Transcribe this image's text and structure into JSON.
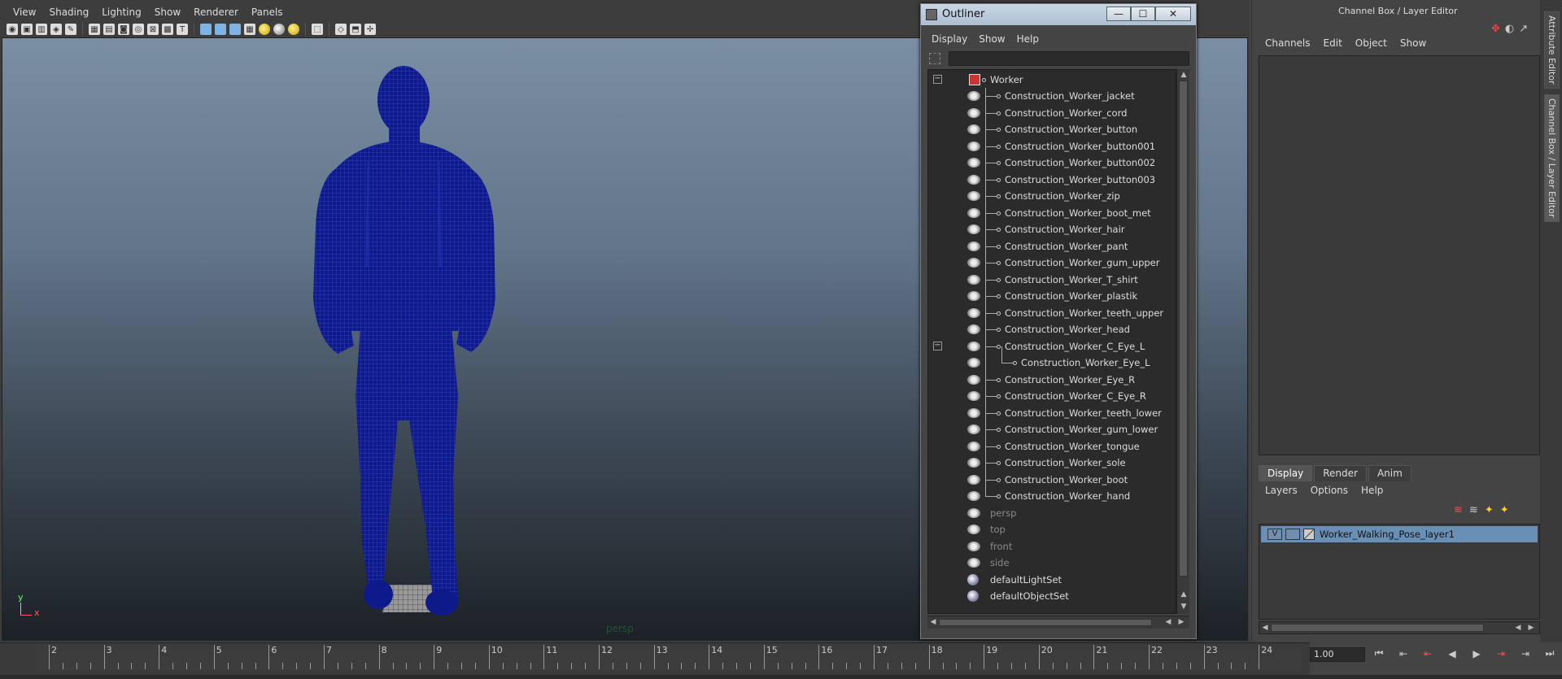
{
  "viewport": {
    "menus": [
      "View",
      "Shading",
      "Lighting",
      "Show",
      "Renderer",
      "Panels"
    ],
    "camera_label": "persp",
    "axis_y": "y",
    "axis_x": "x"
  },
  "outliner": {
    "title": "Outliner",
    "window_buttons": {
      "minimize": "—",
      "maximize": "☐",
      "close": "✕"
    },
    "menus": [
      "Display",
      "Show",
      "Help"
    ],
    "root": "Worker",
    "items": [
      "Construction_Worker_jacket",
      "Construction_Worker_cord",
      "Construction_Worker_button",
      "Construction_Worker_button001",
      "Construction_Worker_button002",
      "Construction_Worker_button003",
      "Construction_Worker_zip",
      "Construction_Worker_boot_met",
      "Construction_Worker_hair",
      "Construction_Worker_pant",
      "Construction_Worker_gum_upper",
      "Construction_Worker_T_shirt",
      "Construction_Worker_plastik",
      "Construction_Worker_teeth_upper",
      "Construction_Worker_head",
      "Construction_Worker_C_Eye_L",
      "Construction_Worker_Eye_L",
      "Construction_Worker_Eye_R",
      "Construction_Worker_C_Eye_R",
      "Construction_Worker_teeth_lower",
      "Construction_Worker_gum_lower",
      "Construction_Worker_tongue",
      "Construction_Worker_sole",
      "Construction_Worker_boot",
      "Construction_Worker_hand"
    ],
    "cameras": [
      "persp",
      "top",
      "front",
      "side"
    ],
    "sets": [
      "defaultLightSet",
      "defaultObjectSet"
    ]
  },
  "channel_box": {
    "title": "Channel Box / Layer Editor",
    "menus": [
      "Channels",
      "Edit",
      "Object",
      "Show"
    ],
    "side_tabs": [
      "Attribute Editor",
      "Channel Box / Layer Editor"
    ],
    "layer_tabs": [
      "Display",
      "Render",
      "Anim"
    ],
    "layer_menus": [
      "Layers",
      "Options",
      "Help"
    ],
    "layer": {
      "visible": "V",
      "name": "Worker_Walking_Pose_layer1"
    }
  },
  "timeline": {
    "ticks": [
      "2",
      "3",
      "4",
      "5",
      "6",
      "7",
      "8",
      "9",
      "10",
      "11",
      "12",
      "13",
      "14",
      "15",
      "16",
      "17",
      "18",
      "19",
      "20",
      "21",
      "22",
      "23",
      "24"
    ],
    "current_frame": "1.00"
  },
  "colors": {
    "wireframe": "#0f1a8a",
    "layer_selected": "#6a8fb5",
    "camera_label": "#26533a"
  }
}
